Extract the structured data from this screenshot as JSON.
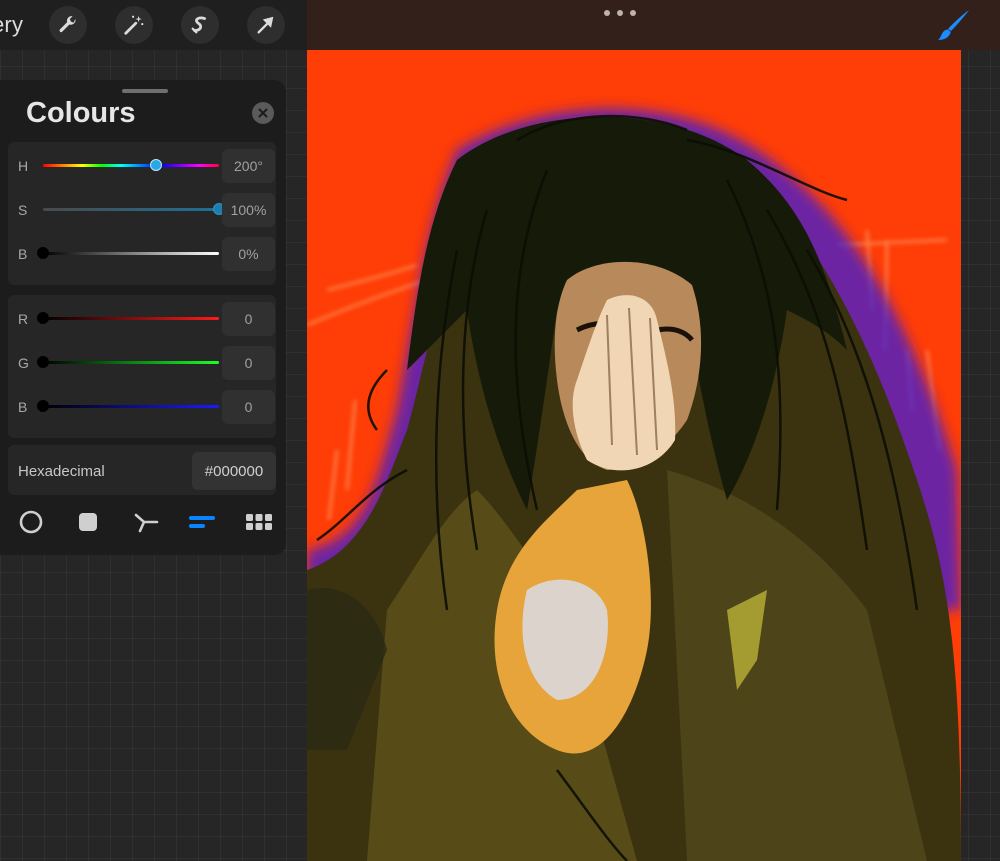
{
  "toolbar": {
    "gallery_label": "ery",
    "tools": [
      "wrench-icon",
      "magic-wand-icon",
      "selection-icon",
      "transform-arrow-icon"
    ],
    "more_icon": "more-dots-icon",
    "brush_icon": "brush-icon",
    "brush_color": "#1a8cff"
  },
  "colour_panel": {
    "title": "Colours",
    "hsb": {
      "hue": {
        "label": "H",
        "value": "200°",
        "level": 0.64
      },
      "saturation": {
        "label": "S",
        "value": "100%",
        "level": 1.0
      },
      "brightness": {
        "label": "B",
        "value": "0%",
        "level": 0.0
      }
    },
    "rgb": {
      "red": {
        "label": "R",
        "value": "0",
        "level": 0.0
      },
      "green": {
        "label": "G",
        "value": "0",
        "level": 0.0
      },
      "blue": {
        "label": "B",
        "value": "0",
        "level": 0.0
      }
    },
    "hex": {
      "label": "Hexadecimal",
      "value": "#000000"
    },
    "modes": [
      "disc-mode-icon",
      "classic-mode-icon",
      "harmony-mode-icon",
      "value-mode-icon",
      "palettes-mode-icon"
    ],
    "active_mode": "value-mode-icon",
    "accent_color": "#0a84ff"
  },
  "canvas": {
    "background_color": "#ff3d06"
  }
}
